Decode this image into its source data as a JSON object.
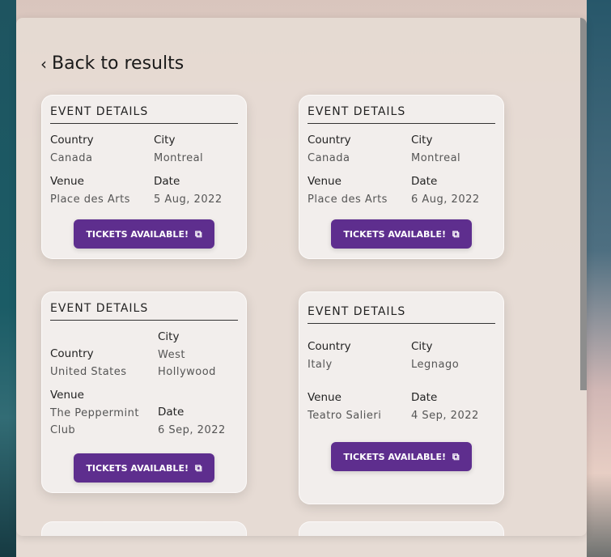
{
  "back_link": {
    "label": "Back to results"
  },
  "cards": [
    {
      "title": "EVENT DETAILS",
      "country_label": "Country",
      "country": "Canada",
      "city_label": "City",
      "city": "Montreal",
      "venue_label": "Venue",
      "venue": "Place des Arts",
      "date_label": "Date",
      "date": "5 Aug, 2022",
      "button": "TICKETS AVAILABLE!"
    },
    {
      "title": "EVENT DETAILS",
      "country_label": "Country",
      "country": "Canada",
      "city_label": "City",
      "city": "Montreal",
      "venue_label": "Venue",
      "venue": "Place des Arts",
      "date_label": "Date",
      "date": "6 Aug, 2022",
      "button": "TICKETS AVAILABLE!"
    },
    {
      "title": "EVENT DETAILS",
      "country_label": "Country",
      "country": "United States",
      "city_label": "City",
      "city": "West Hollywood",
      "venue_label": "Venue",
      "venue": "The Peppermint Club",
      "date_label": "Date",
      "date": "6 Sep, 2022",
      "button": "TICKETS AVAILABLE!"
    },
    {
      "title": "EVENT DETAILS",
      "country_label": "Country",
      "country": "Italy",
      "city_label": "City",
      "city": "Legnago",
      "venue_label": "Venue",
      "venue": "Teatro Salieri",
      "date_label": "Date",
      "date": "4 Sep, 2022",
      "button": "TICKETS AVAILABLE!"
    }
  ],
  "icons": {
    "back": "chevron-left-icon",
    "external": "external-link-icon"
  },
  "colors": {
    "button": "#5e2e8e",
    "panel": "#e6dbd4"
  }
}
